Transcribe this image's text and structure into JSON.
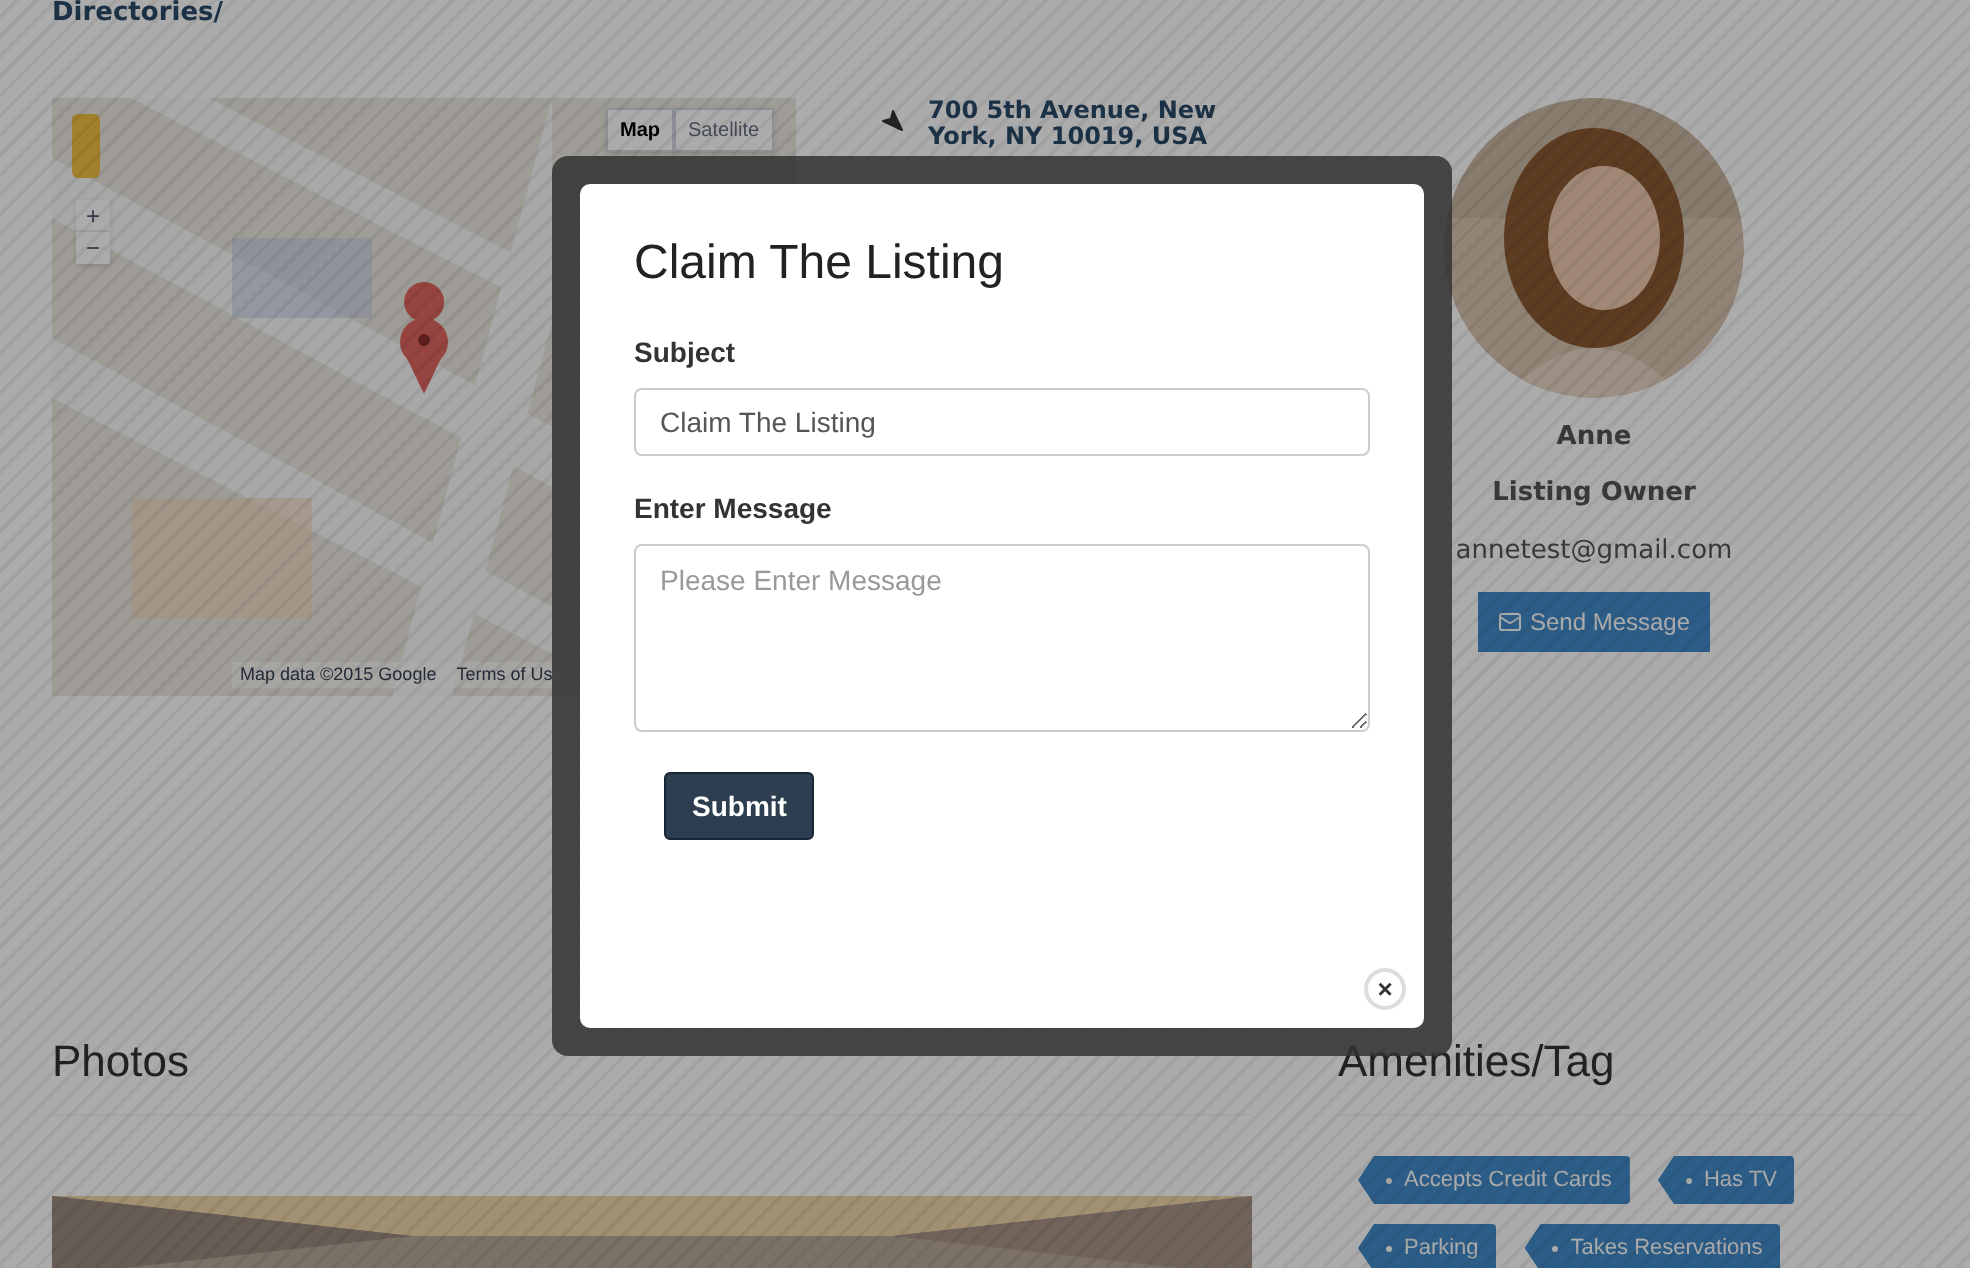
{
  "breadcrumb": "Directories/",
  "map": {
    "kind": "picture",
    "map_types": [
      {
        "label": "Map",
        "selected": true
      },
      {
        "label": "Satellite",
        "selected": false
      }
    ],
    "zoom_in": "+",
    "zoom_out": "−",
    "attribution": "Map data ©2015 Google",
    "terms": "Terms of Us"
  },
  "address": "700 5th Avenue, New York, NY 10019, USA",
  "owner": {
    "name": "Anne",
    "role": "Listing Owner",
    "email": "annetest@gmail.com",
    "button": "Send Message"
  },
  "photos": {
    "title": "Photos"
  },
  "amenities": {
    "title": "Amenities/Tag",
    "tags": [
      "Accepts Credit Cards",
      "Has TV",
      "Parking",
      "Takes Reservations"
    ]
  },
  "modal": {
    "title": "Claim The Listing",
    "subject_label": "Subject",
    "subject_value": "Claim The Listing",
    "message_label": "Enter Message",
    "message_placeholder": "Please Enter Message",
    "submit": "Submit",
    "close": "×"
  }
}
